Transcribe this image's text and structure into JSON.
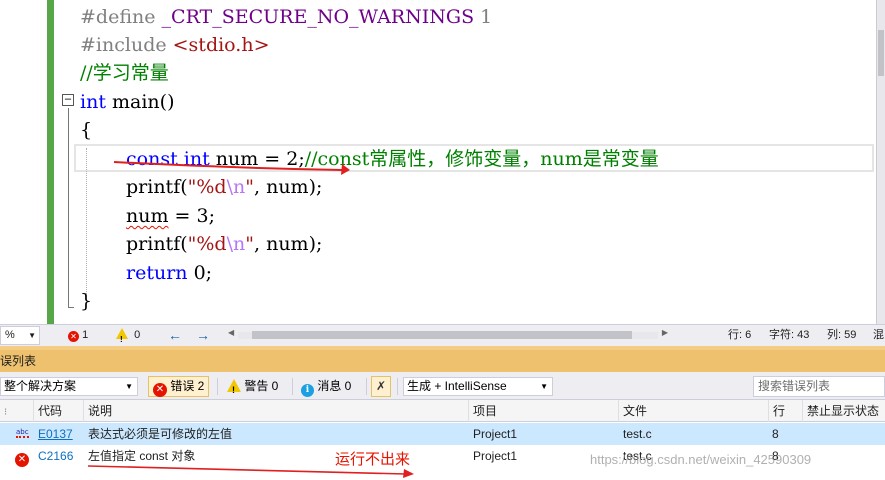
{
  "editor": {
    "lines": [
      {
        "segments": [
          {
            "t": "#define ",
            "c": "pp"
          },
          {
            "t": "_CRT_SECURE_NO_WARNINGS",
            "c": "macro"
          },
          {
            "t": " 1",
            "c": "pp"
          }
        ]
      },
      {
        "segments": [
          {
            "t": "#include ",
            "c": "pp"
          },
          {
            "t": "<stdio.h>",
            "c": "str"
          }
        ]
      },
      {
        "segments": [
          {
            "t": "//学习常量",
            "c": "cm"
          }
        ]
      },
      {
        "segments": [
          {
            "t": "int",
            "c": "kw"
          },
          {
            "t": " main()",
            "c": ""
          }
        ]
      },
      {
        "segments": [
          {
            "t": "{",
            "c": ""
          }
        ]
      },
      {
        "segments": [
          {
            "t": "const",
            "c": "kw"
          },
          {
            "t": " ",
            "c": ""
          },
          {
            "t": "int",
            "c": "kw"
          },
          {
            "t": " num = 2;",
            "c": ""
          },
          {
            "t": "//const常属性，修饰变量，num是常变量",
            "c": "cm"
          }
        ]
      },
      {
        "segments": [
          {
            "t": "printf(",
            "c": ""
          },
          {
            "t": "\"%d",
            "c": "str"
          },
          {
            "t": "\\n",
            "c": "esc"
          },
          {
            "t": "\"",
            "c": "str"
          },
          {
            "t": ", num);",
            "c": ""
          }
        ]
      },
      {
        "segments": [
          {
            "t": "num",
            "c": "squig"
          },
          {
            "t": " = 3;",
            "c": ""
          }
        ]
      },
      {
        "segments": [
          {
            "t": "printf(",
            "c": ""
          },
          {
            "t": "\"%d",
            "c": "str"
          },
          {
            "t": "\\n",
            "c": "esc"
          },
          {
            "t": "\"",
            "c": "str"
          },
          {
            "t": ", num);",
            "c": ""
          }
        ]
      },
      {
        "segments": [
          {
            "t": "return",
            "c": "kw"
          },
          {
            "t": " 0;",
            "c": ""
          }
        ]
      },
      {
        "segments": [
          {
            "t": "}",
            "c": ""
          }
        ]
      }
    ]
  },
  "status": {
    "zoom": "%",
    "errors": "1",
    "warnings": "0",
    "line": "行: 6",
    "chars": "字符: 43",
    "col": "列: 59",
    "mixed": "混"
  },
  "panel": {
    "title": "误列表",
    "scope": "整个解决方案",
    "errors_btn": "错误 2",
    "warnings_btn": "警告 0",
    "messages_btn": "消息 0",
    "build_filter": "生成 + IntelliSense",
    "search_placeholder": "搜索错误列表"
  },
  "grid": {
    "headers": [
      "代码",
      "说明",
      "项目",
      "文件",
      "行",
      "禁止显示状态"
    ],
    "rows": [
      {
        "code": "E0137",
        "desc": "表达式必须是可修改的左值",
        "project": "Project1",
        "file": "test.c",
        "line": "8",
        "suppress": ""
      },
      {
        "code": "C2166",
        "desc": "左值指定 const 对象",
        "project": "Project1",
        "file": "test.c",
        "line": "8",
        "suppress": ""
      }
    ]
  },
  "annotation": "运行不出来",
  "watermark": "https://blog.csdn.net/weixin_42590309"
}
